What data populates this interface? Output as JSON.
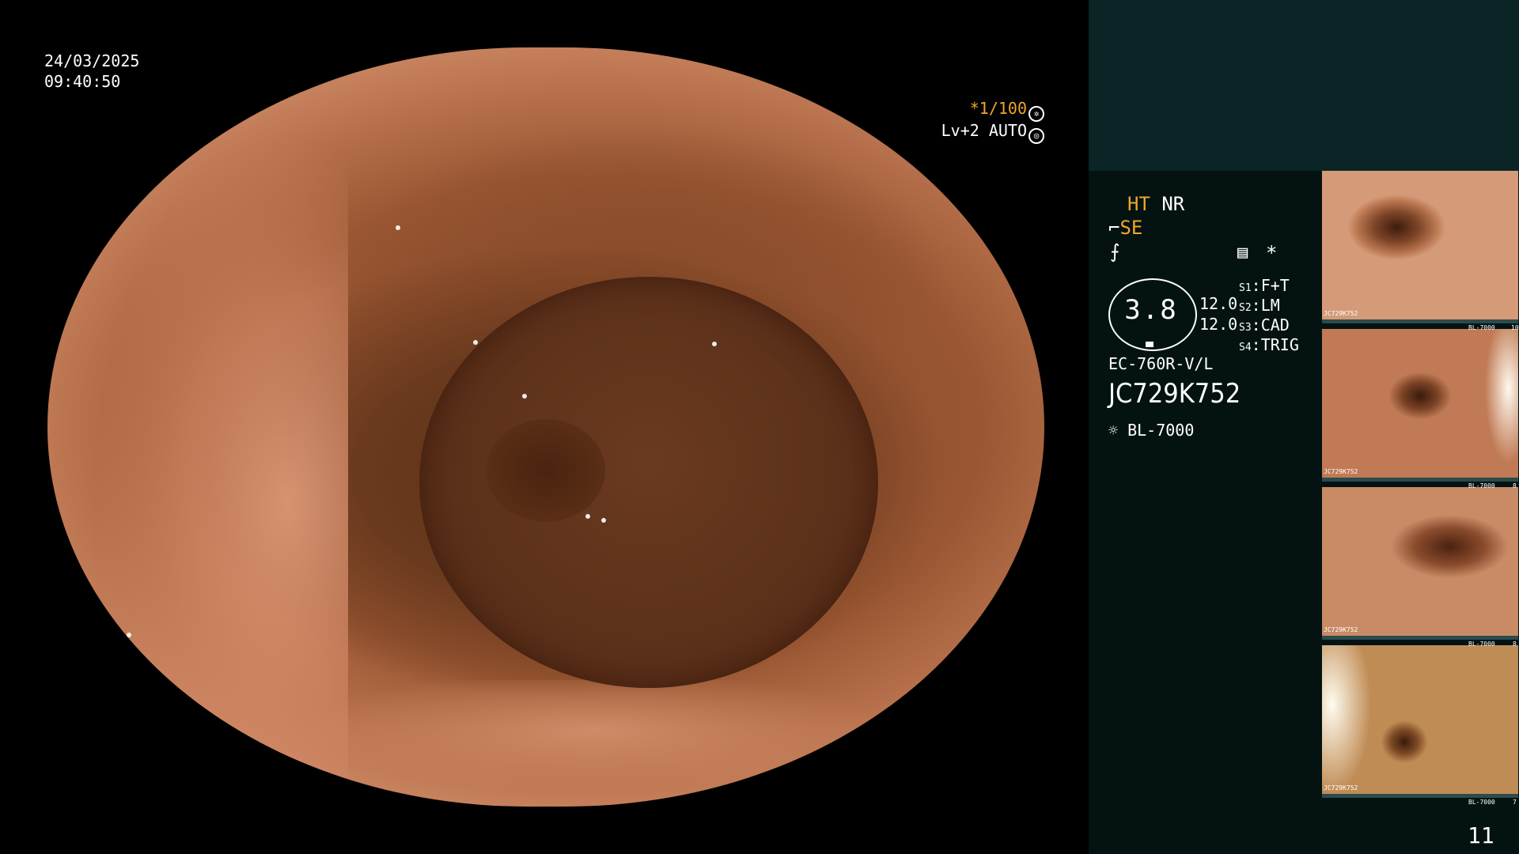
{
  "scope": {
    "date": "24/03/2025",
    "time": "09:40:50",
    "shutter": "*1/100",
    "level": "Lv+2 AUTO"
  },
  "panel": {
    "ht": "HT",
    "nr": "NR",
    "se": "SE",
    "star": "*",
    "gauge_value": "3.8",
    "val1": "12.0",
    "val2": "12.0",
    "slots": [
      {
        "key": "S1",
        "value": "F+T"
      },
      {
        "key": "S2",
        "value": "LM"
      },
      {
        "key": "S3",
        "value": "CAD"
      },
      {
        "key": "S4",
        "value": "TRIG"
      }
    ],
    "scope_model": "EC-760R-V/L",
    "serial": "JC729K752",
    "light_source": "BL-7000",
    "accent_color": "#f0a52a"
  },
  "thumbnails": [
    {
      "caption": "JC729K752",
      "footer": "BL-7000",
      "index": "10"
    },
    {
      "caption": "JC729K752",
      "footer": "BL-7000",
      "index": "8"
    },
    {
      "caption": "JC729K752",
      "footer": "BL-7000",
      "index": "8"
    },
    {
      "caption": "JC729K752",
      "footer": "BL-7000",
      "index": "7"
    }
  ],
  "page_number": "11"
}
